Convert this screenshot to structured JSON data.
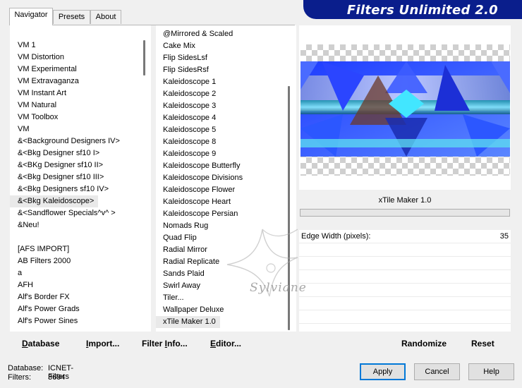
{
  "header": {
    "title": "Filters Unlimited 2.0",
    "banner_color": "#0a1e8c"
  },
  "tabs": [
    {
      "label": "Navigator",
      "active": true
    },
    {
      "label": "Presets",
      "active": false
    },
    {
      "label": "About",
      "active": false
    }
  ],
  "categories": [
    "VM 1",
    "VM Distortion",
    "VM Experimental",
    "VM Extravaganza",
    "VM Instant Art",
    "VM Natural",
    "VM Toolbox",
    "VM",
    "&<Background Designers IV>",
    "&<Bkg Designer sf10 I>",
    "&<BKg Designer sf10 II>",
    "&<Bkg Designer sf10 III>",
    "&<Bkg Designers sf10 IV>",
    "&<Bkg Kaleidoscope>",
    "&<Sandflower Specials^v^ >",
    "&Neu!",
    "",
    "[AFS IMPORT]",
    "AB Filters 2000",
    "a",
    "AFH",
    "Alf's Border FX",
    "Alf's Power Grads",
    "Alf's Power Sines"
  ],
  "selected_category": "&<Bkg Kaleidoscope>",
  "filters": [
    "@Mirrored & Scaled",
    "Cake Mix",
    "Flip SidesLsf",
    "Flip SidesRsf",
    "Kaleidoscope 1",
    "Kaleidoscope 2",
    "Kaleidoscope 3",
    "Kaleidoscope 4",
    "Kaleidoscope 5",
    "Kaleidoscope 8",
    "Kaleidoscope 9",
    "Kaleidoscope Butterfly",
    "Kaleidoscope Divisions",
    "Kaleidoscope Flower",
    "Kaleidoscope Heart",
    "Kaleidoscope Persian",
    "Nomads Rug",
    "Quad Flip",
    "Radial Mirror",
    "Radial Replicate",
    "Sands Plaid",
    "Swirl Away",
    "Tiler...",
    "Wallpaper Deluxe",
    "xTile Maker 1.0"
  ],
  "selected_filter": "xTile Maker 1.0",
  "preview": {
    "filter_name": "xTile Maker 1.0"
  },
  "parameters": [
    {
      "label": "Edge Width (pixels):",
      "value": "35"
    }
  ],
  "toolbar": {
    "database": {
      "u": "D",
      "rest": "atabase"
    },
    "import": {
      "u": "I",
      "rest": "mport..."
    },
    "filter_info": {
      "pre": "Filter ",
      "u": "I",
      "rest": "nfo..."
    },
    "editor": {
      "u": "E",
      "rest": "ditor..."
    },
    "randomize": "Randomize",
    "reset": "Reset"
  },
  "status": {
    "database_label": "Database:",
    "database_value": "ICNET-Filters",
    "filters_label": "Filters:",
    "filters_value": "3694"
  },
  "buttons": {
    "apply": "Apply",
    "cancel": "Cancel",
    "help": "Help"
  },
  "watermark": "Sylviane",
  "colors": {
    "accent": "#0078d7",
    "preview_blue": "#2a4cff",
    "preview_cyan": "#33d6e6"
  }
}
